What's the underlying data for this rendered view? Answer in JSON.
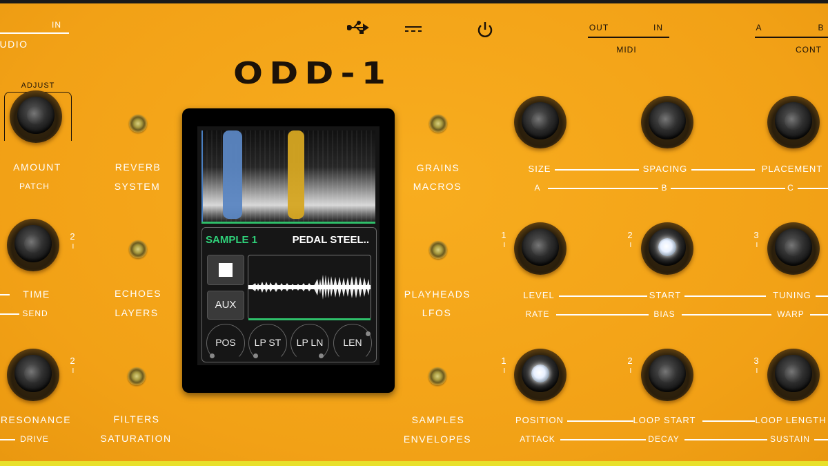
{
  "device": {
    "logo": "ODD-1",
    "top_labels": {
      "in_left": "IN",
      "audio": "UDIO",
      "adjust": "ADJUST",
      "midi_out": "OUT",
      "midi_in": "IN",
      "midi": "MIDI",
      "cont_a": "A",
      "cont_b": "B",
      "cont": "CONT"
    },
    "icons": [
      "usb-icon",
      "dc-power-icon",
      "power-icon"
    ],
    "left_column": [
      {
        "top": "AMOUNT",
        "bottom": "PATCH",
        "number": ""
      },
      {
        "top": "TIME",
        "bottom": "SEND",
        "number": "2"
      },
      {
        "top": "RESONANCE",
        "bottom": "DRIVE",
        "number": "2"
      }
    ],
    "left_buttons": [
      {
        "top": "REVERB",
        "bottom": "SYSTEM"
      },
      {
        "top": "ECHOES",
        "bottom": "LAYERS"
      },
      {
        "top": "FILTERS",
        "bottom": "SATURATION"
      }
    ],
    "right_buttons": [
      {
        "top": "GRAINS",
        "bottom": "MACROS"
      },
      {
        "top": "PLAYHEADS",
        "bottom": "LFOS"
      },
      {
        "top": "SAMPLES",
        "bottom": "ENVELOPES"
      }
    ],
    "knob_rows": [
      {
        "top": [
          "SIZE",
          "SPACING",
          "PLACEMENT"
        ],
        "bottom": [
          "A",
          "B",
          "C"
        ],
        "numbers": [
          "",
          "",
          ""
        ]
      },
      {
        "top": [
          "LEVEL",
          "START",
          "TUNING"
        ],
        "bottom": [
          "RATE",
          "BIAS",
          "WARP"
        ],
        "numbers": [
          "1",
          "2",
          "3"
        ]
      },
      {
        "top": [
          "POSITION",
          "LOOP START",
          "LOOP LENGTH"
        ],
        "bottom": [
          "ATTACK",
          "DECAY",
          "SUSTAIN"
        ],
        "numbers": [
          "1",
          "2",
          "3"
        ]
      }
    ]
  },
  "screen": {
    "sample_label": "SAMPLE 1",
    "sample_name": "PEDAL STEEL..",
    "aux_label": "AUX",
    "params": [
      "POS",
      "LP ST",
      "LP LN",
      "LEN"
    ],
    "colors": {
      "accent_green": "#2fd27a",
      "marker_blue": "#5b86c2",
      "marker_yellow": "#d6a622"
    }
  }
}
